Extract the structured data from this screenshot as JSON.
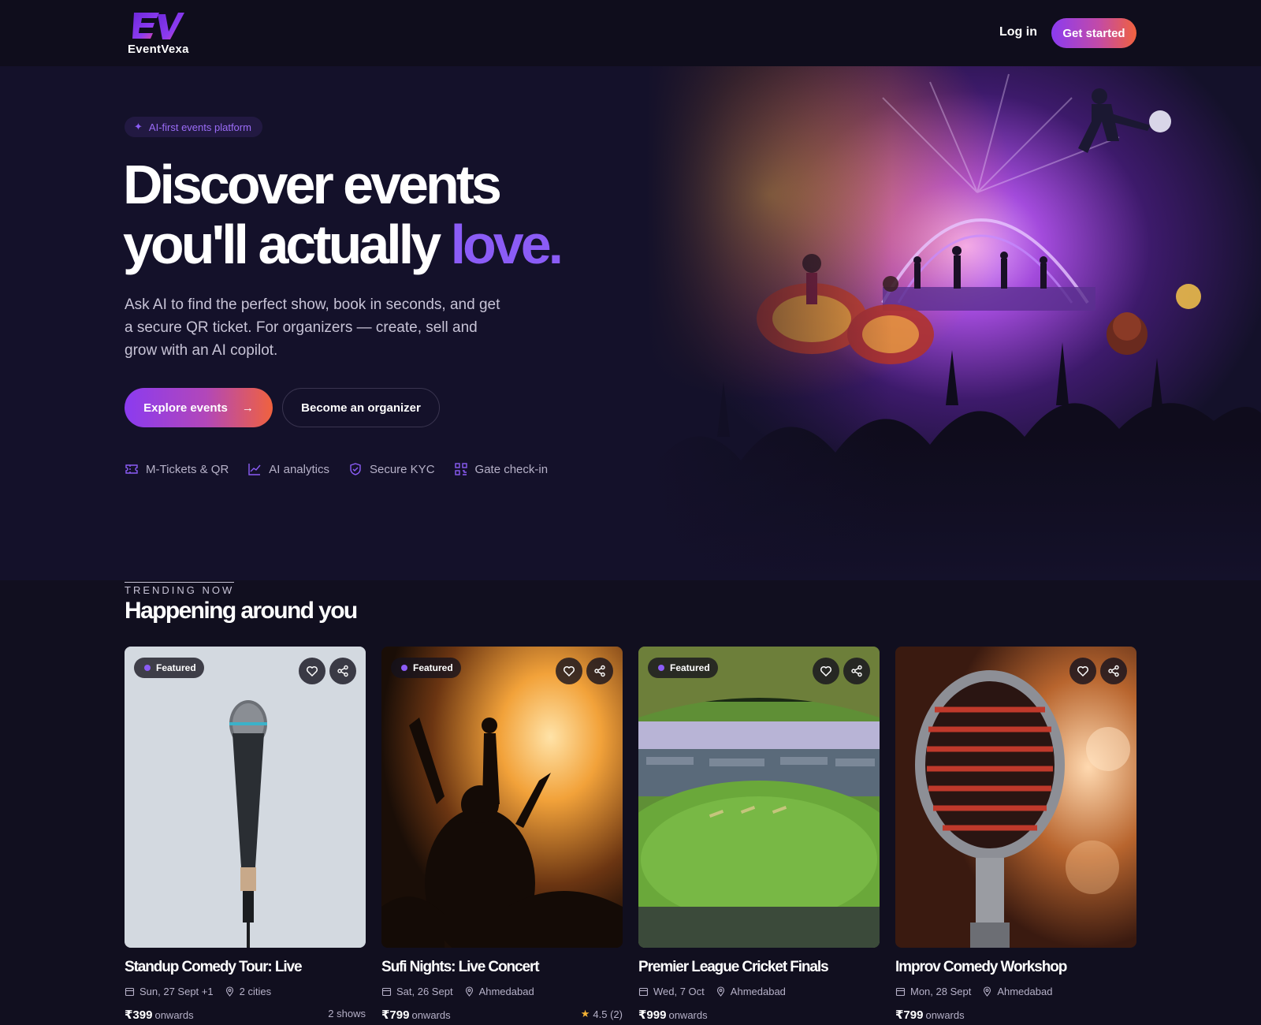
{
  "brand": {
    "name": "EventVexa"
  },
  "nav": {
    "login": "Log in",
    "get_started": "Get started"
  },
  "hero": {
    "badge": "AI-first events platform",
    "title_line1": "Discover events",
    "title_line2": "you'll actually",
    "title_highlight": "love.",
    "subtitle": "Ask AI to find the perfect show, book in seconds, and get a secure QR ticket. For organizers — create, sell and grow with an AI copilot.",
    "cta_primary": "Explore events",
    "cta_secondary": "Become an organizer",
    "features": [
      {
        "icon": "ticket-icon",
        "label": "M-Tickets & QR"
      },
      {
        "icon": "chart-line-icon",
        "label": "AI analytics"
      },
      {
        "icon": "shield-check-icon",
        "label": "Secure KYC"
      },
      {
        "icon": "qr-code-icon",
        "label": "Gate check-in"
      }
    ]
  },
  "trending": {
    "kicker": "TRENDING NOW",
    "title": "Happening around you",
    "cards": [
      {
        "featured": "Featured",
        "title": "Standup Comedy Tour: Live",
        "date": "Sun, 27 Sept +1",
        "location": "2 cities",
        "price": "₹399",
        "price_suffix": "onwards",
        "extra": "2 shows",
        "image": "microphone-on-light-background"
      },
      {
        "featured": "Featured",
        "title": "Sufi Nights: Live Concert",
        "date": "Sat, 26 Sept",
        "location": "Ahmedabad",
        "price": "₹799",
        "price_suffix": "onwards",
        "extra": "4.5 (2)",
        "image": "concert-crowd-silhouette"
      },
      {
        "featured": "Featured",
        "title": "Premier League Cricket Finals",
        "date": "Wed, 7 Oct",
        "location": "Ahmedabad",
        "price": "₹999",
        "price_suffix": "onwards",
        "extra": "",
        "image": "cricket-stadium"
      },
      {
        "featured": "",
        "title": "Improv Comedy Workshop",
        "date": "Mon, 28 Sept",
        "location": "Ahmedabad",
        "price": "₹799",
        "price_suffix": "onwards",
        "extra": "",
        "image": "vintage-microphone-red-light"
      }
    ]
  },
  "colors": {
    "background": "#110f1f",
    "hero_background": "#14112a",
    "accent_purple": "#8b5cf6",
    "gradient_start": "#8b3bf0",
    "gradient_end": "#f0623e",
    "rating_star": "#f5b335"
  }
}
